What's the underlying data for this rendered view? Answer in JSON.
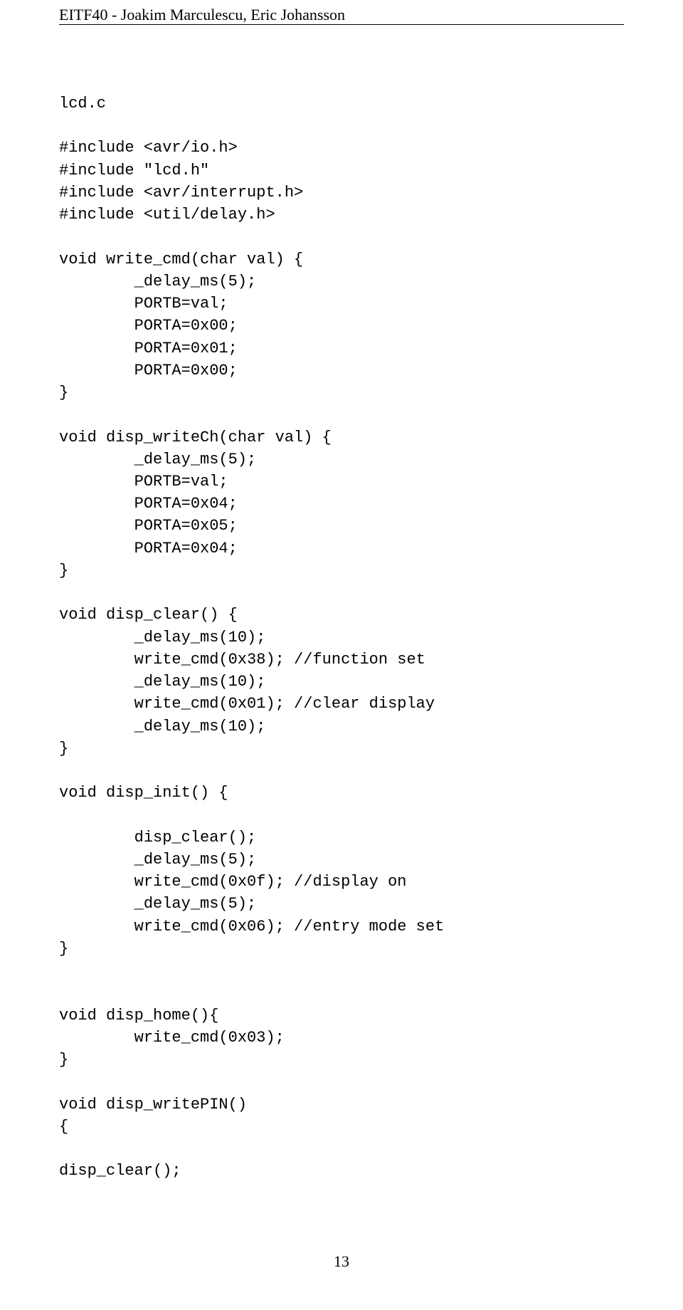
{
  "header": "EITF40 - Joakim Marculescu, Eric Johansson",
  "code": "lcd.c\n\n#include <avr/io.h>\n#include \"lcd.h\"\n#include <avr/interrupt.h>\n#include <util/delay.h>\n\nvoid write_cmd(char val) {\n        _delay_ms(5);\n        PORTB=val;\n        PORTA=0x00;\n        PORTA=0x01;\n        PORTA=0x00;\n}\n\nvoid disp_writeCh(char val) {\n        _delay_ms(5);\n        PORTB=val;\n        PORTA=0x04;\n        PORTA=0x05;\n        PORTA=0x04;\n}\n\nvoid disp_clear() {\n        _delay_ms(10);\n        write_cmd(0x38); //function set\n        _delay_ms(10);\n        write_cmd(0x01); //clear display\n        _delay_ms(10);\n}\n\nvoid disp_init() {\n\n        disp_clear();\n        _delay_ms(5);\n        write_cmd(0x0f); //display on\n        _delay_ms(5);\n        write_cmd(0x06); //entry mode set\n}\n\n\nvoid disp_home(){\n        write_cmd(0x03);\n}\n\nvoid disp_writePIN()\n{\n\ndisp_clear();",
  "pageNumber": "13"
}
